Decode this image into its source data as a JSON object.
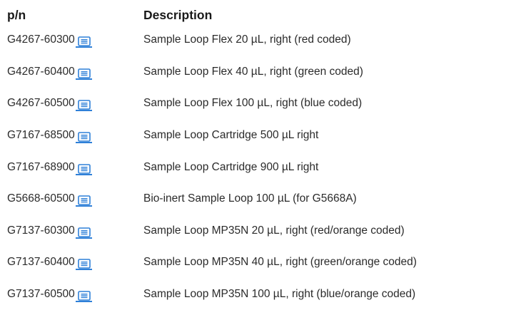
{
  "table": {
    "headers": {
      "pn": "p/n",
      "description": "Description"
    },
    "shop_icon": "shop-link-icon",
    "accent_color": "#2f80d8",
    "rows": [
      {
        "pn": "G4267-60300",
        "description": "Sample Loop Flex 20 µL, right (red coded)"
      },
      {
        "pn": "G4267-60400",
        "description": "Sample Loop Flex 40 µL, right (green coded)"
      },
      {
        "pn": "G4267-60500",
        "description": "Sample Loop Flex 100 µL, right (blue coded)"
      },
      {
        "pn": "G7167-68500",
        "description": "Sample Loop Cartridge 500 µL right"
      },
      {
        "pn": "G7167-68900",
        "description": "Sample Loop Cartridge 900 µL right"
      },
      {
        "pn": "G5668-60500",
        "description": "Bio-inert Sample Loop 100 µL (for G5668A)"
      },
      {
        "pn": "G7137-60300",
        "description": "Sample Loop MP35N 20 µL, right (red/orange coded)"
      },
      {
        "pn": "G7137-60400",
        "description": "Sample Loop MP35N 40 µL, right (green/orange coded)"
      },
      {
        "pn": "G7137-60500",
        "description": "Sample Loop MP35N 100 µL, right (blue/orange coded)"
      }
    ]
  }
}
